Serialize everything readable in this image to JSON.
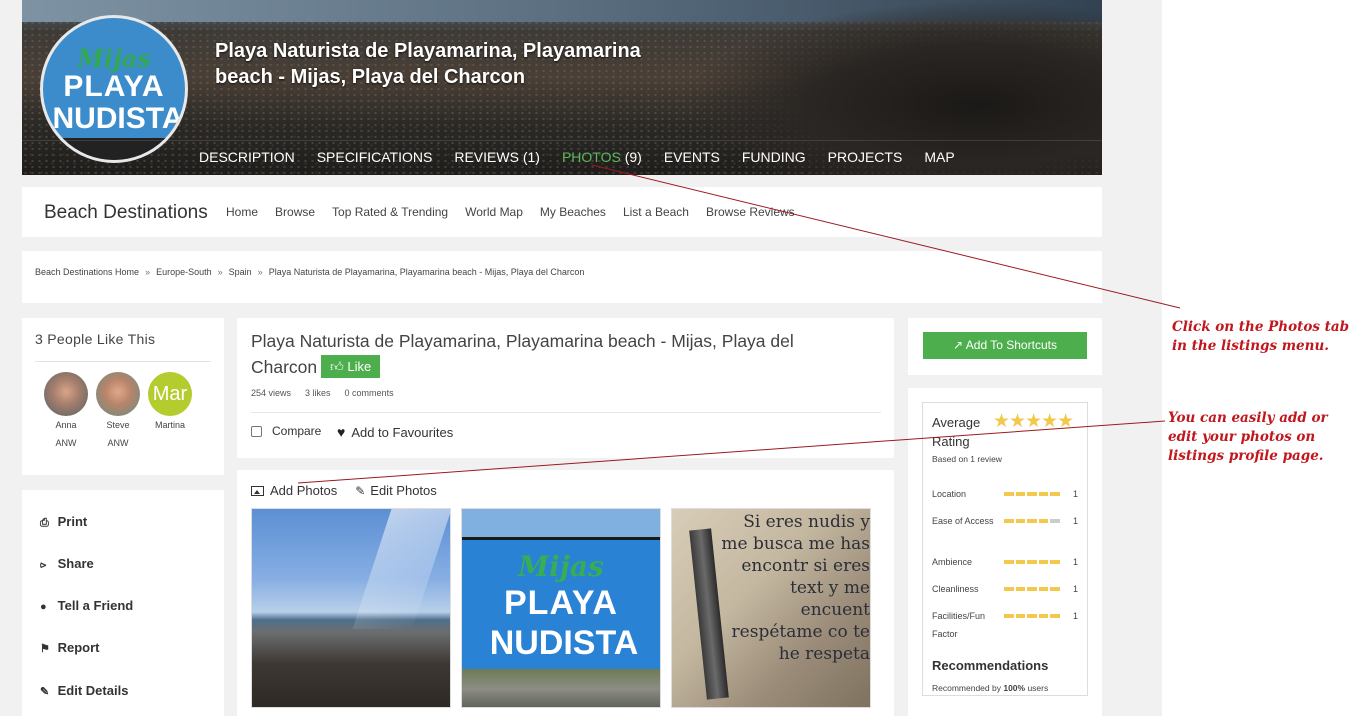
{
  "listing": {
    "title": "Playa Naturista de Playamarina, Playamarina beach - Mijas, Playa del Charcon",
    "title_line1": "Playa Naturista de Playamarina, Playamarina",
    "title_line2": "beach - Mijas, Playa del Charcon",
    "logo_text": {
      "top": "Mijas",
      "middle": "PLAYA",
      "bottom": "NUDISTA"
    }
  },
  "listing_tabs": [
    {
      "label": "DESCRIPTION",
      "count": ""
    },
    {
      "label": "SPECIFICATIONS",
      "count": ""
    },
    {
      "label": "REVIEWS",
      "count": "(1)"
    },
    {
      "label": "PHOTOS",
      "count": "(9)",
      "active": true
    },
    {
      "label": "EVENTS",
      "count": ""
    },
    {
      "label": "FUNDING",
      "count": ""
    },
    {
      "label": "PROJECTS",
      "count": ""
    },
    {
      "label": "MAP",
      "count": ""
    }
  ],
  "site_nav": {
    "brand": "Beach Destinations",
    "items": [
      "Home",
      "Browse",
      "Top Rated & Trending",
      "World Map",
      "My Beaches",
      "List a Beach",
      "Browse Reviews"
    ]
  },
  "breadcrumb": [
    "Beach Destinations Home",
    "Europe-South",
    "Spain",
    "Playa Naturista de Playamarina, Playamarina beach - Mijas, Playa del Charcon"
  ],
  "breadcrumb_sep": "»",
  "likes": {
    "heading": "3 People Like This",
    "people": [
      {
        "name": "Anna",
        "sub": "ANW"
      },
      {
        "name": "Steve",
        "sub": "ANW"
      },
      {
        "name": "Martina",
        "sub": "",
        "initials": "Mar"
      }
    ]
  },
  "actions": [
    "Print",
    "Share",
    "Tell a Friend",
    "Report",
    "Edit Details"
  ],
  "main": {
    "like_label": "Like",
    "stats": [
      "254 views",
      "3 likes",
      "0 comments"
    ],
    "compare_label": "Compare",
    "favourites_label": "Add to Favourites"
  },
  "photos": {
    "add_label": "Add Photos",
    "edit_label": "Edit Photos",
    "thumb3_text": "Si eres nudis y me busca me has encontr si eres text y me encuent respétame co te he respeta"
  },
  "shortcuts_label": "Add To Shortcuts",
  "rating": {
    "title": "Average Rating",
    "stars": 5,
    "based_on": "Based on 1 review",
    "criteria": [
      {
        "label": "Location",
        "value": "1",
        "filled": 5
      },
      {
        "label": "Ease of Access",
        "value": "1",
        "filled": 4
      },
      {
        "label": "Ambience",
        "value": "1",
        "filled": 5
      },
      {
        "label": "Cleanliness",
        "value": "1",
        "filled": 5
      },
      {
        "label": "Facilities/Fun Factor",
        "value": "1",
        "filled": 5
      }
    ],
    "recommendations_heading": "Recommendations",
    "recommended_prefix": "Recommended by ",
    "recommended_pct": "100%",
    "recommended_suffix": " users"
  },
  "annotations": {
    "photos_tab_line1": "Click on the Photos tab",
    "photos_tab_line2": "in the listings menu.",
    "add_photos_line1": "You can easily add or",
    "add_photos_line2": "edit your photos on",
    "add_photos_line3": "listings profile page."
  },
  "colors": {
    "accent_green": "#4cae4c",
    "active_tab": "#5cb85c",
    "star": "#f2c94c",
    "annotation": "#c0161c"
  }
}
